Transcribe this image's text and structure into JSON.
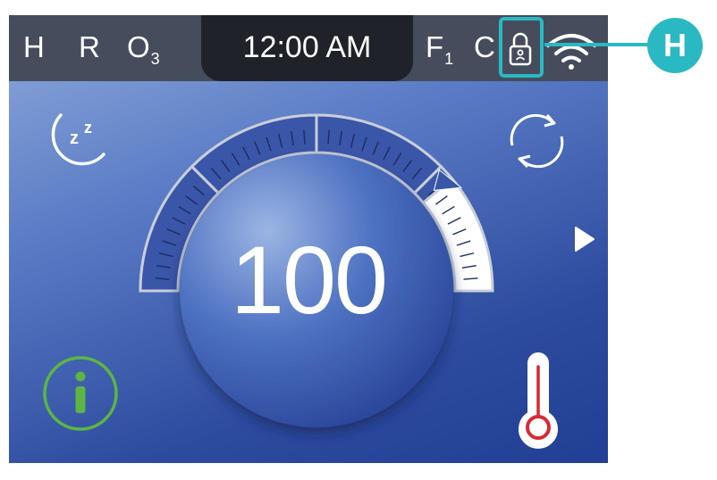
{
  "topbar": {
    "left_indicators": [
      {
        "label": "H",
        "sub": ""
      },
      {
        "label": "R",
        "sub": ""
      },
      {
        "label": "O",
        "sub": "3"
      }
    ],
    "clock": "12:00 AM",
    "right_indicators": [
      {
        "label": "F",
        "sub": "1"
      },
      {
        "label": "C",
        "sub": ""
      }
    ],
    "icons": [
      "lock-icon",
      "wifi-icon"
    ]
  },
  "main": {
    "set_value": "100",
    "dial_level_fraction": 0.78,
    "icons": [
      "sleep-moon-icon",
      "refresh-cycle-icon",
      "next-arrow-icon",
      "info-icon",
      "thermometer-icon"
    ]
  },
  "callout": {
    "label": "H",
    "target": "lock-icon"
  },
  "colors": {
    "topbar": "#454d5d",
    "clock_pill": "#1f2329",
    "background_top": "#8ea9da",
    "background_bottom": "#213f94",
    "callout": "#2ab9c3",
    "info_green": "#5cb544",
    "thermometer_red": "#d62b35",
    "dial_fill": "#3a56a8"
  }
}
